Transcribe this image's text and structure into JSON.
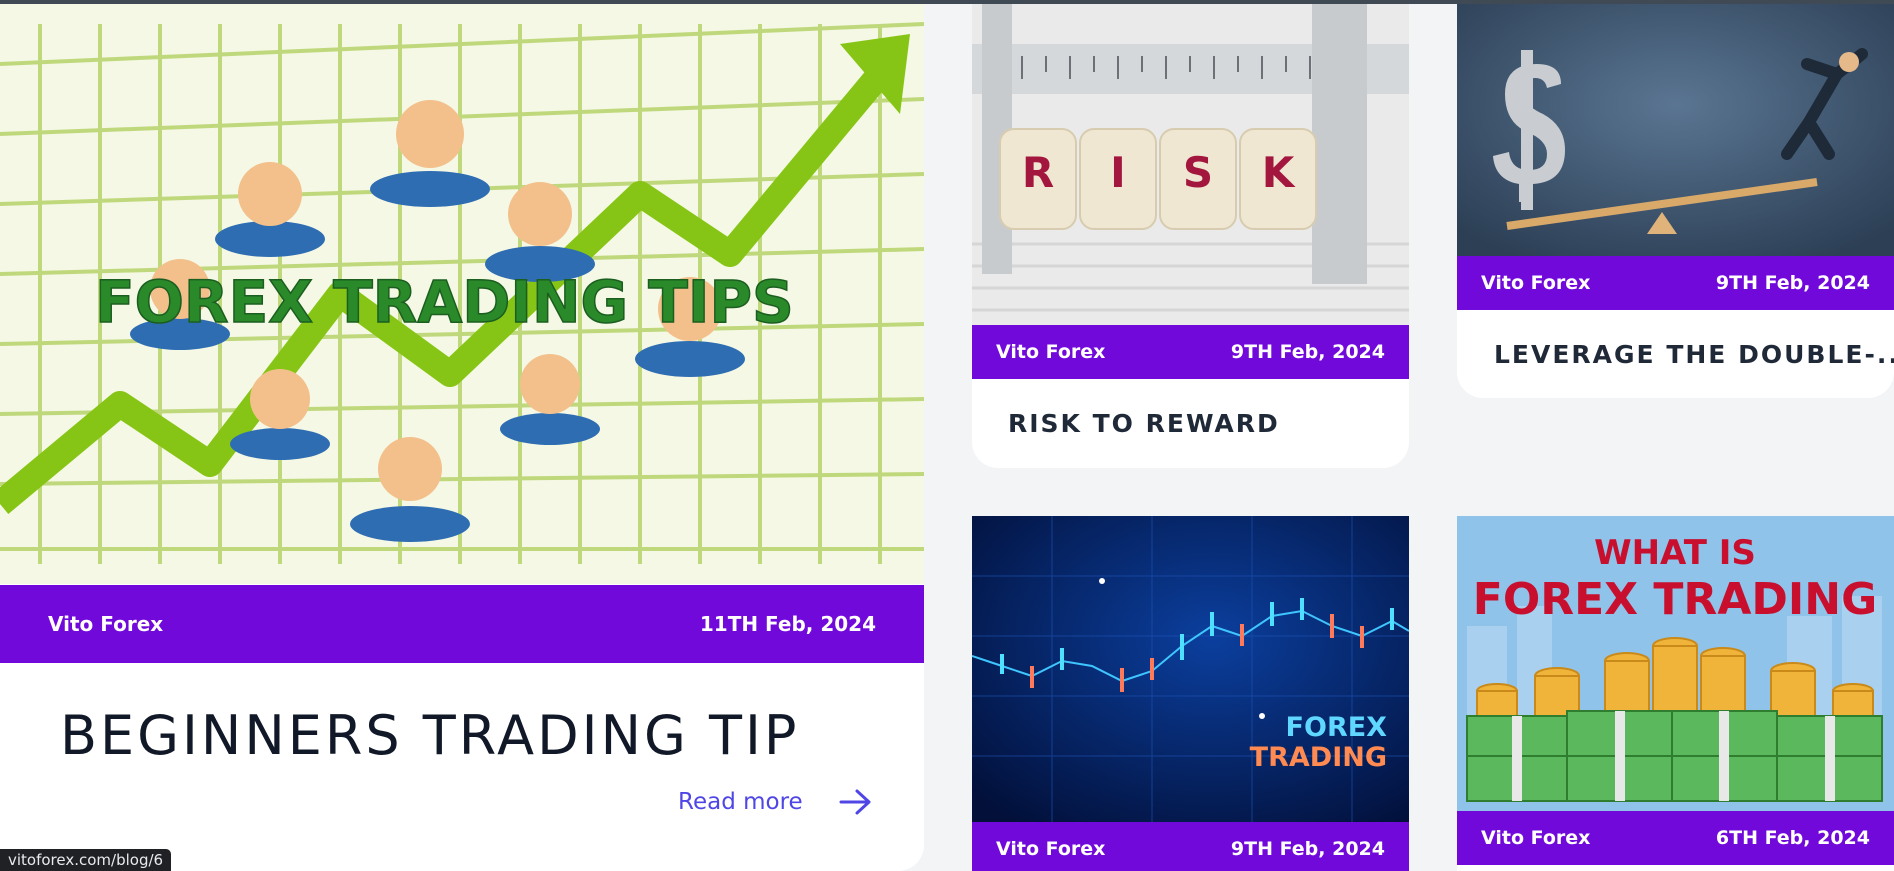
{
  "posts": {
    "main": {
      "image_text": "FOREX TRADING TIPS",
      "author": "Vito Forex",
      "date": "11TH Feb, 2024",
      "title": "BEGINNERS TRADING TIP",
      "read_more": "Read more"
    },
    "risk": {
      "image_letters": [
        "R",
        "I",
        "S",
        "K"
      ],
      "author": "Vito Forex",
      "date": "9TH Feb, 2024",
      "title": "RISK TO REWARD"
    },
    "leverage": {
      "author": "Vito Forex",
      "date": "9TH Feb, 2024",
      "title": "LEVERAGE THE DOUBLE-..."
    },
    "chart": {
      "image_line1": "FOREX",
      "image_line2": "TRADING",
      "author": "Vito Forex",
      "date": "9TH Feb, 2024"
    },
    "what": {
      "image_line1": "WHAT IS",
      "image_line2": "FOREX TRADING",
      "author": "Vito Forex",
      "date": "6TH Feb, 2024"
    }
  },
  "status_bar": {
    "url": "vitoforex.com/blog/6"
  },
  "colors": {
    "meta_bar": "#7209db",
    "link": "#4f46e5",
    "title": "#111827"
  },
  "icons": {
    "read_more": "arrow-right-icon"
  }
}
